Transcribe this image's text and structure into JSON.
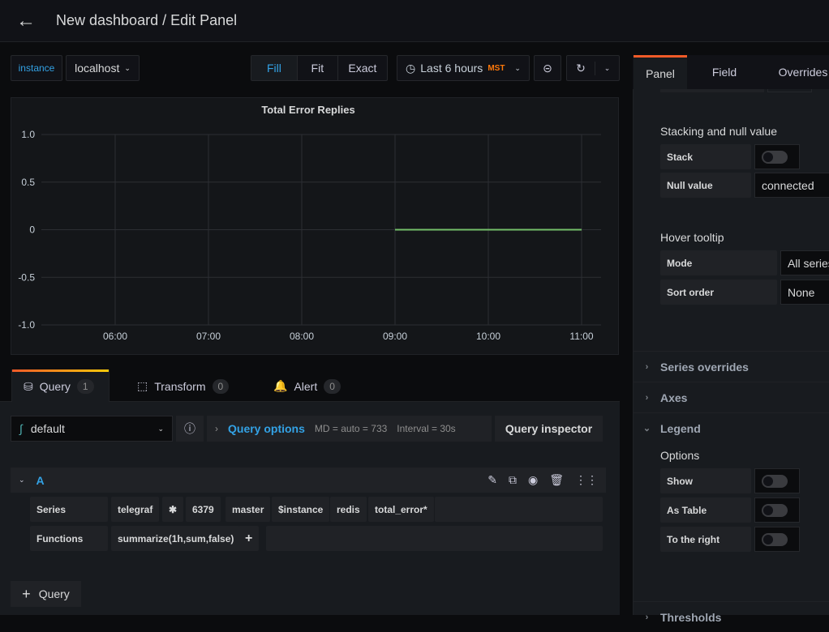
{
  "header": {
    "title": "New dashboard / Edit Panel",
    "back_icon": "arrow-left-icon"
  },
  "toolbar": {
    "variable_label": "instance",
    "variable_value": "localhost",
    "fill": "Fill",
    "fit": "Fit",
    "exact": "Exact",
    "time_range": "Last 6 hours",
    "timezone": "MST"
  },
  "colors": {
    "accent": "#33a2e5",
    "series": "#73bf69",
    "timezone": "#ff780a"
  },
  "chart_data": {
    "type": "line",
    "title": "Total Error Replies",
    "ylim": [
      -1,
      1
    ],
    "yticks": [
      "1.0",
      "0.5",
      "0",
      "-0.5",
      "-1.0"
    ],
    "xticks": [
      "06:00",
      "07:00",
      "08:00",
      "09:00",
      "10:00",
      "11:00"
    ],
    "grid": true,
    "legend": "none",
    "series": [
      {
        "x": [
          "09:00",
          "10:00",
          "11:00"
        ],
        "values": [
          0,
          0,
          0
        ]
      }
    ]
  },
  "query_tabs": [
    {
      "label": "Query",
      "count": "1"
    },
    {
      "label": "Transform",
      "count": "0"
    },
    {
      "label": "Alert",
      "count": "0"
    }
  ],
  "query": {
    "datasource": "default",
    "options_label": "Query options",
    "md": "MD = auto = 733",
    "interval": "Interval = 30s",
    "inspector": "Query inspector",
    "ref": "A",
    "series_label": "Series",
    "segments": [
      "telegraf",
      "✱",
      "6379",
      "master",
      "$instance",
      "redis",
      "total_error*"
    ],
    "functions_label": "Functions",
    "function": "summarize(1h,sum,false)",
    "add": "+",
    "add_query": "Query"
  },
  "right": {
    "tabs": [
      "Panel",
      "Field",
      "Overrides"
    ],
    "stacking_title": "Stacking and null value",
    "stack_label": "Stack",
    "stack_on": false,
    "null_label": "Null value",
    "null_value": "connected",
    "hover_title": "Hover tooltip",
    "mode_label": "Mode",
    "mode_value": "All series",
    "sort_label": "Sort order",
    "sort_value": "None",
    "sections": [
      "Series overrides",
      "Axes",
      "Legend"
    ],
    "options_title": "Options",
    "legend_opts": [
      {
        "label": "Show",
        "on": false
      },
      {
        "label": "As Table",
        "on": false
      },
      {
        "label": "To the right",
        "on": false
      }
    ],
    "next_section": "Thresholds"
  }
}
